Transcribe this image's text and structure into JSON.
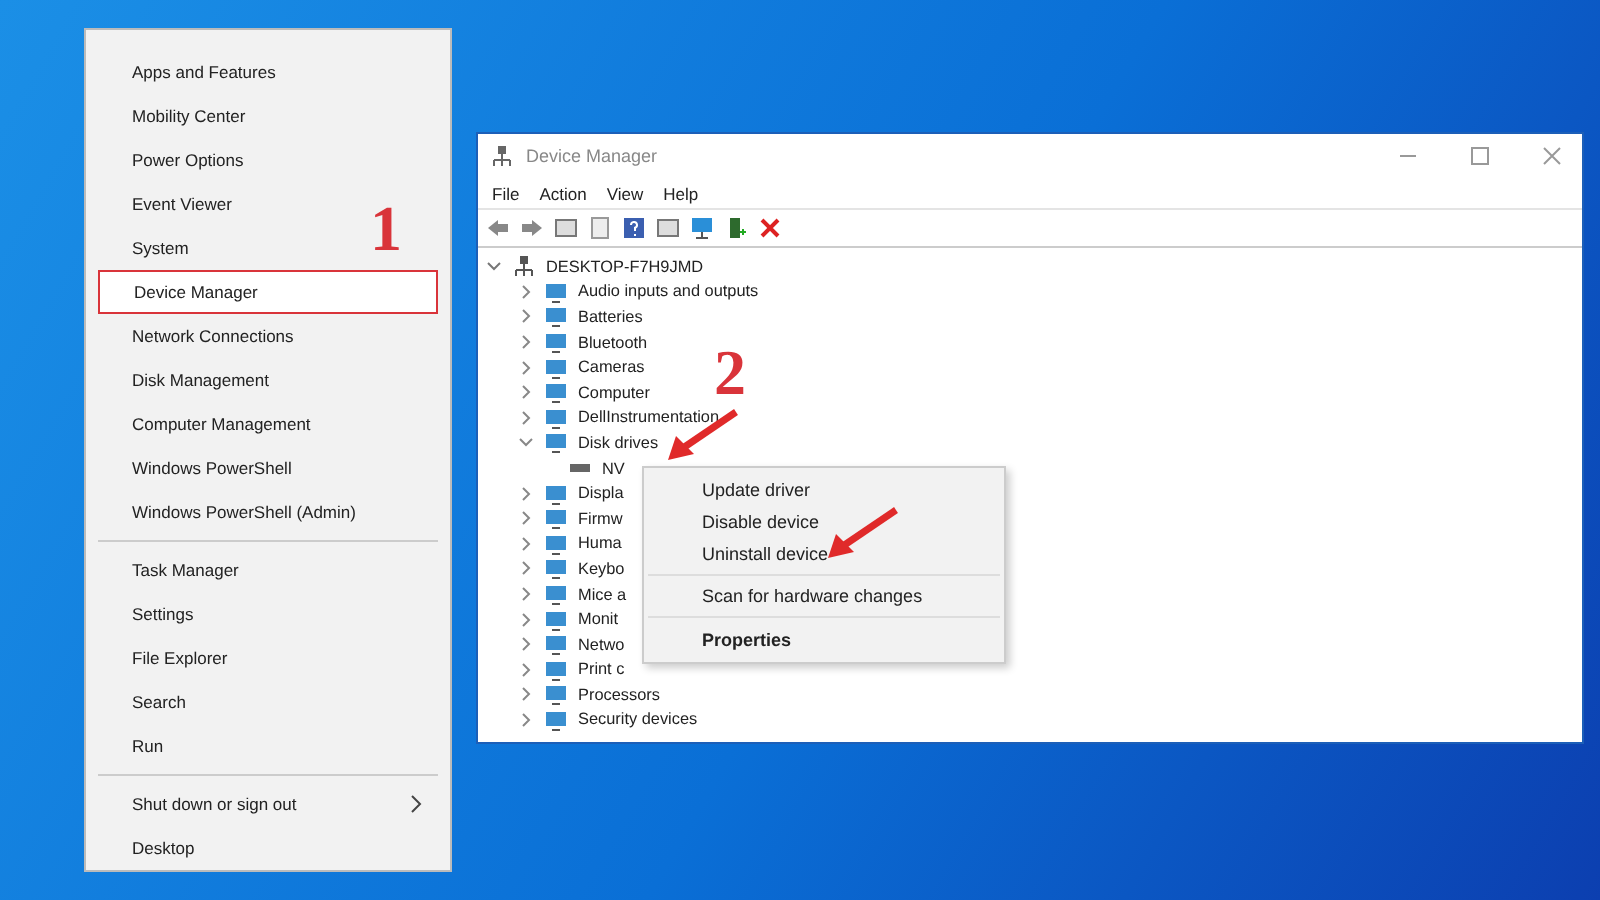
{
  "quick_menu": {
    "items": [
      {
        "kind": "item",
        "label": "Apps and Features",
        "annotated": false,
        "submenu": false
      },
      {
        "kind": "item",
        "label": "Mobility Center",
        "annotated": false,
        "submenu": false
      },
      {
        "kind": "item",
        "label": "Power Options",
        "annotated": false,
        "submenu": false
      },
      {
        "kind": "item",
        "label": "Event Viewer",
        "annotated": false,
        "submenu": false
      },
      {
        "kind": "item",
        "label": "System",
        "annotated": false,
        "submenu": false
      },
      {
        "kind": "item",
        "label": "Device Manager",
        "annotated": true,
        "submenu": false
      },
      {
        "kind": "item",
        "label": "Network Connections",
        "annotated": false,
        "submenu": false
      },
      {
        "kind": "item",
        "label": "Disk Management",
        "annotated": false,
        "submenu": false
      },
      {
        "kind": "item",
        "label": "Computer Management",
        "annotated": false,
        "submenu": false
      },
      {
        "kind": "item",
        "label": "Windows PowerShell",
        "annotated": false,
        "submenu": false
      },
      {
        "kind": "item",
        "label": "Windows PowerShell (Admin)",
        "annotated": false,
        "submenu": false
      },
      {
        "kind": "separator"
      },
      {
        "kind": "item",
        "label": "Task Manager",
        "annotated": false,
        "submenu": false
      },
      {
        "kind": "item",
        "label": "Settings",
        "annotated": false,
        "submenu": false
      },
      {
        "kind": "item",
        "label": "File Explorer",
        "annotated": false,
        "submenu": false
      },
      {
        "kind": "item",
        "label": "Search",
        "annotated": false,
        "submenu": false
      },
      {
        "kind": "item",
        "label": "Run",
        "annotated": false,
        "submenu": false
      },
      {
        "kind": "separator"
      },
      {
        "kind": "item",
        "label": "Shut down or sign out",
        "annotated": false,
        "submenu": true
      },
      {
        "kind": "item",
        "label": "Desktop",
        "annotated": false,
        "submenu": false
      }
    ]
  },
  "window": {
    "title": "Device Manager",
    "menu_bar": [
      "File",
      "Action",
      "View",
      "Help"
    ],
    "tree": {
      "label": "DESKTOP-F7H9JMD",
      "expanded": true,
      "children": [
        {
          "label": "Audio inputs and outputs",
          "expanded": false
        },
        {
          "label": "Batteries",
          "expanded": false
        },
        {
          "label": "Bluetooth",
          "expanded": false
        },
        {
          "label": "Cameras",
          "expanded": false
        },
        {
          "label": "Computer",
          "expanded": false
        },
        {
          "label": "DellInstrumentation",
          "expanded": false
        },
        {
          "label": "Disk drives",
          "expanded": true,
          "children": [
            {
              "label": "NV"
            }
          ]
        },
        {
          "label": "Displa",
          "expanded": false
        },
        {
          "label": "Firmw",
          "expanded": false
        },
        {
          "label": "Huma",
          "expanded": false
        },
        {
          "label": "Keybo",
          "expanded": false
        },
        {
          "label": "Mice a",
          "expanded": false
        },
        {
          "label": "Monit",
          "expanded": false
        },
        {
          "label": "Netwo",
          "expanded": false
        },
        {
          "label": "Print c",
          "expanded": false
        },
        {
          "label": "Processors",
          "expanded": false
        },
        {
          "label": "Security devices",
          "expanded": false
        }
      ]
    },
    "context_menu": [
      {
        "kind": "item",
        "label": "Update driver"
      },
      {
        "kind": "item",
        "label": "Disable device"
      },
      {
        "kind": "item",
        "label": "Uninstall device"
      },
      {
        "kind": "separator"
      },
      {
        "kind": "item",
        "label": "Scan for hardware changes"
      },
      {
        "kind": "separator"
      },
      {
        "kind": "default",
        "label": "Properties"
      }
    ]
  },
  "annotations": [
    {
      "label": "1"
    },
    {
      "label": "2"
    }
  ]
}
